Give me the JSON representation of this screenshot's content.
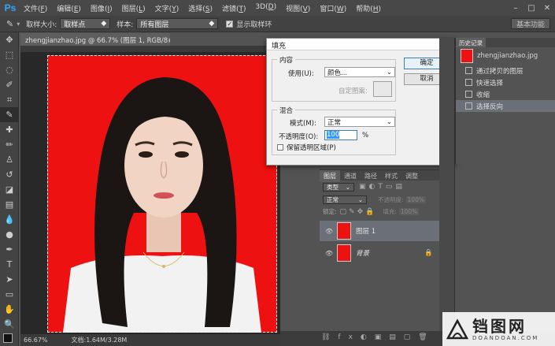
{
  "app": {
    "logo": "Ps"
  },
  "menu": [
    {
      "label": "文件(",
      "key": "F",
      "end": ")"
    },
    {
      "label": "编辑(",
      "key": "E",
      "end": ")"
    },
    {
      "label": "图像(",
      "key": "I",
      "end": ")"
    },
    {
      "label": "图层(",
      "key": "L",
      "end": ")"
    },
    {
      "label": "文字(",
      "key": "Y",
      "end": ")"
    },
    {
      "label": "选择(",
      "key": "S",
      "end": ")"
    },
    {
      "label": "滤镜(",
      "key": "T",
      "end": ")"
    },
    {
      "label": "3D(",
      "key": "D",
      "end": ")"
    },
    {
      "label": "视图(",
      "key": "V",
      "end": ")"
    },
    {
      "label": "窗口(",
      "key": "W",
      "end": ")"
    },
    {
      "label": "帮助(",
      "key": "H",
      "end": ")"
    }
  ],
  "options": {
    "sample_size_label": "取样大小:",
    "sample_size_value": "取样点",
    "sample_label": "样本:",
    "sample_value": "所有图层",
    "show_ring_label": "显示取样环",
    "workspace": "基本功能"
  },
  "document": {
    "tab_title": "zhengjianzhao.jpg @ 66.7% (图层 1, RGB/8#) *",
    "zoom": "66.67%",
    "doc_info": "文档:1.64M/3.28M"
  },
  "dialog": {
    "title": "填充",
    "contents_group": "内容",
    "use_label": "使用(U):",
    "use_value": "颜色...",
    "custom_pattern_label": "自定图案:",
    "blending_group": "混合",
    "mode_label": "模式(M):",
    "mode_value": "正常",
    "opacity_label": "不透明度(O):",
    "opacity_value": "100",
    "opacity_unit": "%",
    "preserve_label": "保留透明区域(P)",
    "ok": "确定",
    "cancel": "取消"
  },
  "history": {
    "tab": "历史记录",
    "snapshot_name": "zhengjianzhao.jpg",
    "items": [
      "通过拷贝的图层",
      "快速选择",
      "收缩",
      "选择反向"
    ],
    "selected_index": 3
  },
  "layers": {
    "tabs": [
      "图层",
      "通道",
      "路径",
      "样式",
      "调整"
    ],
    "filter_kind": "类型",
    "blend_mode": "正常",
    "opacity_label": "不透明度:",
    "opacity_value": "100%",
    "lock_label": "锁定:",
    "fill_label": "填充:",
    "fill_value": "100%",
    "items": [
      {
        "name": "图层 1"
      },
      {
        "name": "背景"
      }
    ]
  },
  "watermark": {
    "brand": "铛图网",
    "domain": "DOANDOAN.COM"
  },
  "colors": {
    "canvas_bg": "#ee1111",
    "accent": "#31a8ff"
  }
}
